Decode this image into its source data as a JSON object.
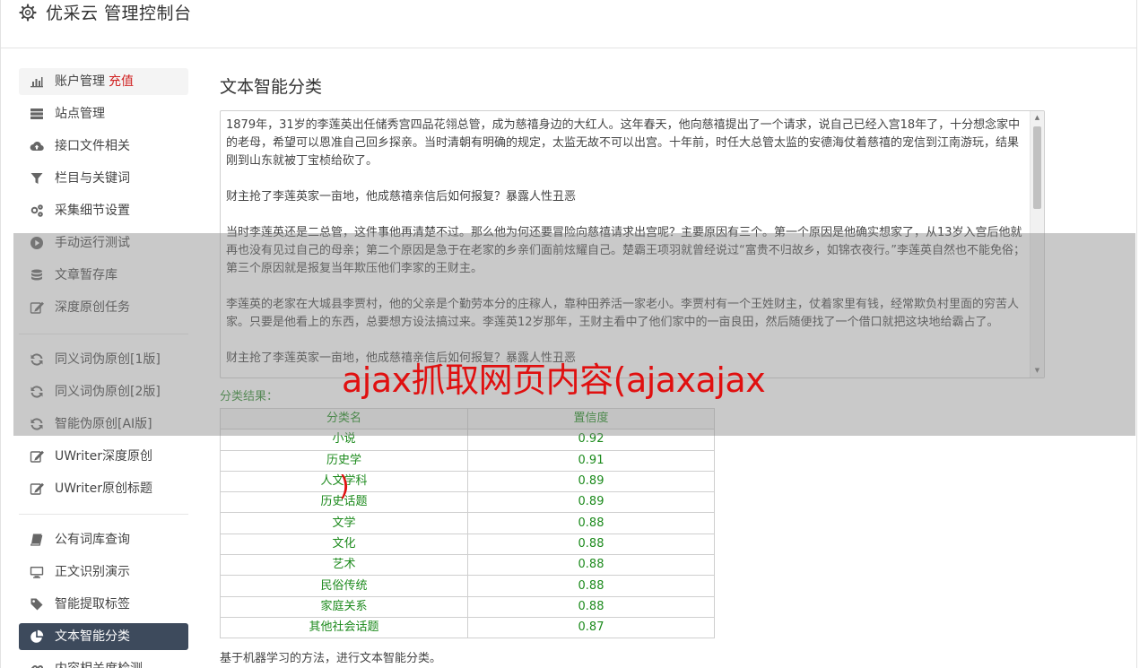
{
  "header": {
    "title": "优采云 管理控制台"
  },
  "sidebar": {
    "items": [
      {
        "label": "账户管理",
        "badge": "充值",
        "icon": "bar-chart-icon"
      },
      {
        "label": "站点管理",
        "icon": "server-icon"
      },
      {
        "label": "接口文件相关",
        "icon": "cloud-upload-icon"
      },
      {
        "label": "栏目与关键词",
        "icon": "filter-icon"
      },
      {
        "label": "采集细节设置",
        "icon": "gears-icon"
      },
      {
        "label": "手动运行测试",
        "icon": "play-circle-icon"
      },
      {
        "label": "文章暂存库",
        "icon": "database-icon"
      },
      {
        "label": "深度原创任务",
        "icon": "edit-icon"
      },
      {
        "label": "同义词伪原创[1版]",
        "icon": "refresh-icon"
      },
      {
        "label": "同义词伪原创[2版]",
        "icon": "refresh-icon"
      },
      {
        "label": "智能伪原创[AI版]",
        "icon": "refresh-icon"
      },
      {
        "label": "UWriter深度原创",
        "icon": "edit-icon"
      },
      {
        "label": "UWriter原创标题",
        "icon": "edit-icon"
      },
      {
        "label": "公有词库查询",
        "icon": "book-icon"
      },
      {
        "label": "正文识别演示",
        "icon": "desktop-icon"
      },
      {
        "label": "智能提取标签",
        "icon": "tag-icon"
      },
      {
        "label": "文本智能分类",
        "icon": "pie-chart-icon"
      },
      {
        "label": "内容相关度检测",
        "icon": "link-icon"
      }
    ]
  },
  "main": {
    "title": "文本智能分类",
    "paragraphs": [
      "1879年，31岁的李莲英出任储秀宫四品花翎总管，成为慈禧身边的大红人。这年春天，他向慈禧提出了一个请求，说自己已经入宫18年了，十分想念家中的老母，希望可以恩准自己回乡探亲。当时清朝有明确的规定，太监无故不可以出宫。十年前，时任大总管太监的安德海仗着慈禧的宠信到江南游玩，结果刚到山东就被丁宝桢给砍了。",
      "财主抢了李莲英家一亩地，他成慈禧亲信后如何报复？暴露人性丑恶",
      "当时李莲英还是二总管，这件事他再清楚不过。那么他为何还要冒险向慈禧请求出宫呢？主要原因有三个。第一个原因是他确实想家了，从13岁入宫后他就再也没有见过自己的母亲；第二个原因是急于在老家的乡亲们面前炫耀自己。楚霸王项羽就曾经说过“富贵不归故乡，如锦衣夜行。”李莲英自然也不能免俗；第三个原因就是报复当年欺压他们李家的王财主。",
      "李莲英的老家在大城县李贾村，他的父亲是个勤劳本分的庄稼人，靠种田养活一家老小。李贾村有一个王姓财主，仗着家里有钱，经常欺负村里面的穷苦人家。只要是他看上的东西，总要想方设法搞过来。李莲英12岁那年，王财主看中了他们家中的一亩良田，然后随便找了一个借口就把这块地给霸占了。",
      "财主抢了李莲英家一亩地，他成慈禧亲信后如何报复？暴露人性丑恶"
    ],
    "result_label": "分类结果：",
    "table": {
      "headers": [
        "分类名",
        "置信度"
      ],
      "rows": [
        [
          "小说",
          "0.92"
        ],
        [
          "历史学",
          "0.91"
        ],
        [
          "人文学科",
          "0.89"
        ],
        [
          "历史话题",
          "0.89"
        ],
        [
          "文学",
          "0.88"
        ],
        [
          "文化",
          "0.88"
        ],
        [
          "艺术",
          "0.88"
        ],
        [
          "民俗传统",
          "0.88"
        ],
        [
          "家庭关系",
          "0.88"
        ],
        [
          "其他社会话题",
          "0.87"
        ]
      ]
    },
    "footnote": "基于机器学习的方法，进行文本智能分类。"
  },
  "overlay": {
    "title": "ajax抓取网页内容(ajaxajax",
    "paren": ")"
  },
  "colors": {
    "active_nav": "#3d4a5c",
    "result_green": "#1c8a1c",
    "recharge_red": "#d02020",
    "overlay_red": "#e01010"
  }
}
